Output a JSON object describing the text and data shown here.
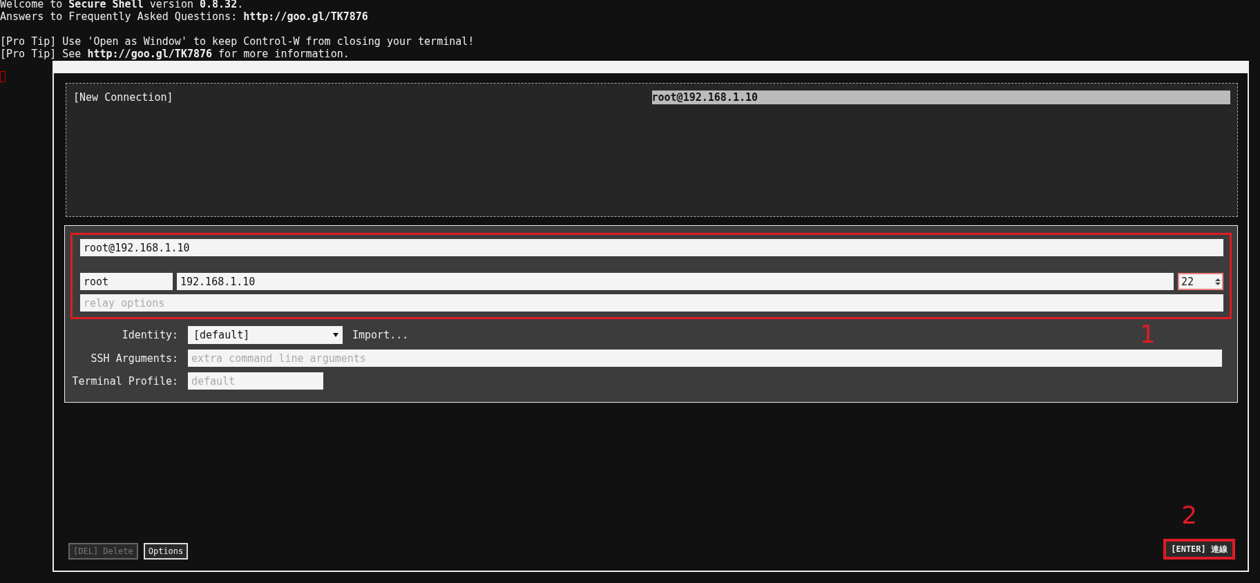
{
  "terminal": {
    "paragraphs": [
      [
        "Welcome to **Secure Shell** version **0.8.32**.",
        "Answers to Frequently Asked Questions: **http://goo.gl/TK7876**"
      ],
      [
        "[Pro Tip] Use 'Open as Window' to keep Control-W from closing your terminal!",
        "[Pro Tip] See **http://goo.gl/TK7876** for more information."
      ]
    ]
  },
  "connections": [
    {
      "label": "[New Connection]",
      "selected": false
    },
    {
      "label": "root@192.168.1.10",
      "selected": true
    }
  ],
  "form": {
    "destination": {
      "value": "root@192.168.1.10"
    },
    "username": {
      "value": "root"
    },
    "hostname": {
      "value": "192.168.1.10"
    },
    "port": {
      "value": "22",
      "focused": true
    },
    "relay": {
      "placeholder": "relay options"
    },
    "identity": {
      "label": "Identity:",
      "value": "[default]"
    },
    "import": "Import...",
    "ssh_args": {
      "label": "SSH Arguments:",
      "placeholder": "extra command line arguments"
    },
    "profile": {
      "label": "Terminal Profile:",
      "placeholder": "default"
    }
  },
  "buttons": [
    {
      "label": "[DEL] Delete",
      "disabled": true
    },
    {
      "label": "Options",
      "disabled": false
    }
  ],
  "connect_button": {
    "label": "[ENTER] 連線"
  },
  "annotations": [
    {
      "label": "1"
    },
    {
      "label": "2"
    }
  ]
}
